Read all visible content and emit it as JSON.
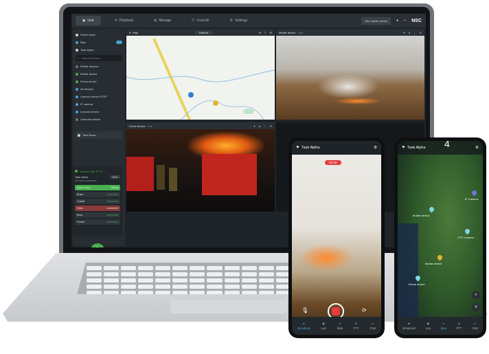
{
  "nav": {
    "tabs": [
      {
        "icon": "live-icon",
        "label": "Live"
      },
      {
        "icon": "playback-icon",
        "label": "Playback"
      },
      {
        "icon": "manage-icon",
        "label": "Manage"
      },
      {
        "icon": "livelink-icon",
        "label": "LiveLink"
      },
      {
        "icon": "settings-icon",
        "label": "Settings"
      }
    ],
    "add_device": "Add mobile device",
    "brand": "NSC"
  },
  "sidebar": {
    "select_tasks": "Select tasks",
    "map": "Map",
    "team": "Task Alpha",
    "search_placeholder": "Search devices...",
    "devices": [
      "Mobile devices",
      "Mobile device",
      "Drone device",
      "All devices",
      "Camera device RTSP",
      "IP camera",
      "Livecam device",
      "Unknown device"
    ],
    "team_bravo": "Task Bravo"
  },
  "talk": {
    "header": "Push-to-Talk (PTT)",
    "group": "Task Alpha",
    "end": "End",
    "status": "All users connected",
    "members": [
      {
        "name": "Alpha (You)",
        "status": "Talking",
        "color": "#48b04f"
      },
      {
        "name": "Bravo",
        "status": "connected",
        "color": "#2f363b"
      },
      {
        "name": "Charlie",
        "status": "connected",
        "color": "#2f363b"
      },
      {
        "name": "Delta",
        "status": "connected",
        "color": "#8a3a3a"
      },
      {
        "name": "Echo",
        "status": "connected",
        "color": "#2f363b"
      },
      {
        "name": "Foxtrot",
        "status": "connected",
        "color": "#2f363b"
      }
    ]
  },
  "panes": {
    "map": {
      "title": "Map",
      "layer": "Default"
    },
    "top_right": {
      "title": "Mobile device",
      "sub": "Live"
    },
    "bottom": {
      "title": "Drone device",
      "sub": "Live"
    }
  },
  "phone_left": {
    "title": "Task Alpha",
    "rec": "00:00",
    "nav": [
      "Broadcast",
      "Live",
      "Map",
      "PTT",
      "Chat"
    ]
  },
  "phone_right": {
    "title": "Task Alpha",
    "badge": "4",
    "nav": [
      "Broadcast",
      "Live",
      "Map",
      "PTT",
      "Chat"
    ],
    "pins": [
      "IP Camera",
      "Mobile device",
      "PTZ Camera",
      "Mobile device",
      "Drone device"
    ]
  }
}
